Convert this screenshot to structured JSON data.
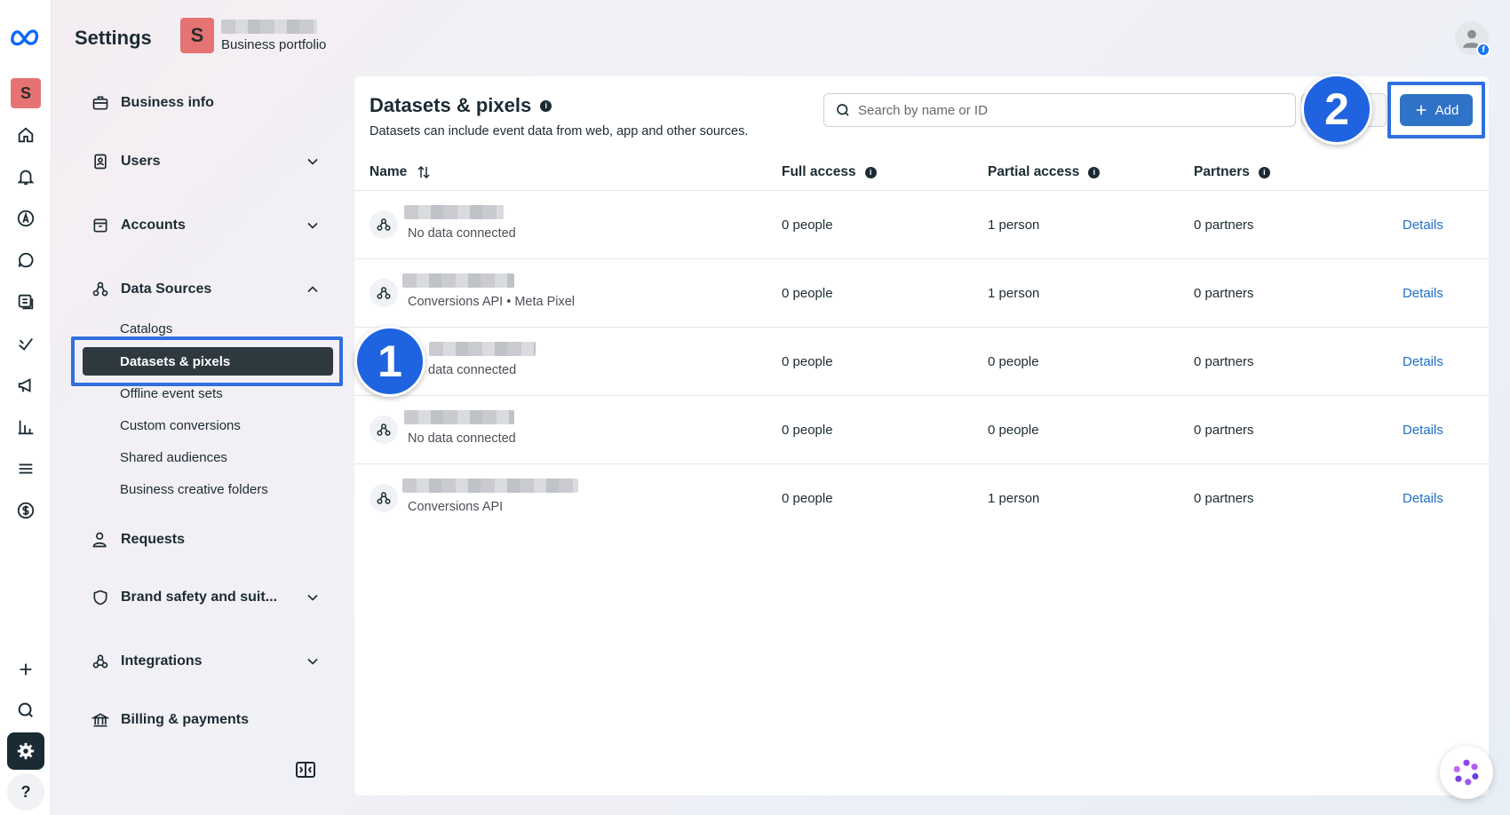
{
  "header": {
    "title": "Settings",
    "portfolio_initial": "S",
    "portfolio_label": "Business portfolio"
  },
  "rail": {
    "avatar_initial": "S",
    "help_label": "?",
    "icons": [
      "meta-logo-icon",
      "home-icon",
      "bell-icon",
      "compass-icon",
      "chat-icon",
      "pages-icon",
      "leaf-icon",
      "megaphone-icon",
      "bar-chart-icon",
      "menu-icon",
      "dollar-icon",
      "plus-icon",
      "search-icon",
      "gear-icon",
      "help-icon"
    ]
  },
  "sidebar": {
    "items": [
      {
        "label": "Business info"
      },
      {
        "label": "Users"
      },
      {
        "label": "Accounts"
      },
      {
        "label": "Data Sources"
      },
      {
        "label": "Requests"
      },
      {
        "label": "Brand safety and suit..."
      },
      {
        "label": "Integrations"
      },
      {
        "label": "Billing & payments"
      }
    ],
    "data_sources_children": [
      {
        "label": "Catalogs"
      },
      {
        "label": "Datasets & pixels"
      },
      {
        "label": "Offline event sets"
      },
      {
        "label": "Custom conversions"
      },
      {
        "label": "Shared audiences"
      },
      {
        "label": "Business creative folders"
      }
    ]
  },
  "annotations": {
    "step1": "1",
    "step2": "2",
    "highlight_color": "#2f6fde"
  },
  "main": {
    "title": "Datasets & pixels",
    "subtitle": "Datasets can include event data from web, app and other sources.",
    "search_placeholder": "Search by name or ID",
    "add_label": "Add",
    "columns": {
      "name": "Name",
      "full_access": "Full access",
      "partial_access": "Partial access",
      "partners": "Partners"
    },
    "rows": [
      {
        "subtitle": "No data connected",
        "full": "0 people",
        "partial": "1 person",
        "partners": "0 partners",
        "action": "Details"
      },
      {
        "subtitle": "Conversions API • Meta Pixel",
        "full": "0 people",
        "partial": "1 person",
        "partners": "0 partners",
        "action": "Details"
      },
      {
        "subtitle": "data connected",
        "full": "0 people",
        "partial": "0 people",
        "partners": "0 partners",
        "action": "Details"
      },
      {
        "subtitle": "No data connected",
        "full": "0 people",
        "partial": "0 people",
        "partners": "0 partners",
        "action": "Details"
      },
      {
        "subtitle": "Conversions API",
        "full": "0 people",
        "partial": "1 person",
        "partners": "0 partners",
        "action": "Details"
      }
    ]
  },
  "colors": {
    "accent": "#2f73c9",
    "link": "#1f6fc7",
    "active_nav": "#2f3940"
  }
}
